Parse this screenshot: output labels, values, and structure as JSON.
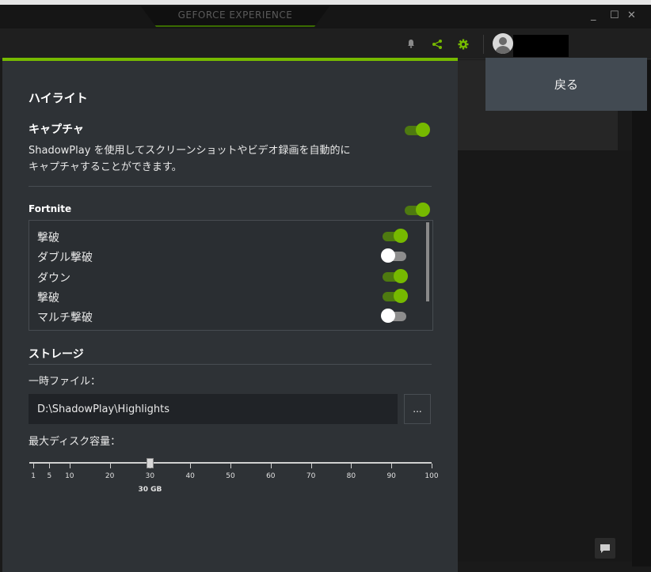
{
  "app": {
    "title": "GEFORCE EXPERIENCE",
    "window_controls": {
      "minimize": "_",
      "maximize": "☐",
      "close": "✕"
    }
  },
  "header": {
    "icons": [
      "bell-icon",
      "share-icon",
      "gear-icon",
      "avatar-icon"
    ]
  },
  "back_label": "戻る",
  "highlights": {
    "title": "ハイライト",
    "capture": {
      "title": "キャプチャ",
      "desc_line1": "ShadowPlay を使用してスクリーンショットやビデオ録画を自動的に",
      "desc_line2": "キャプチャすることができます。",
      "enabled": true
    },
    "game": {
      "name": "Fortnite",
      "enabled": true,
      "events": [
        {
          "label": "撃破",
          "enabled": true
        },
        {
          "label": "ダブル撃破",
          "enabled": false
        },
        {
          "label": "ダウン",
          "enabled": true
        },
        {
          "label": "撃破",
          "enabled": true
        },
        {
          "label": "マルチ撃破",
          "enabled": false
        }
      ]
    }
  },
  "storage": {
    "title": "ストレージ",
    "temp_label": "一時ファイル：",
    "temp_path": "D:\\ShadowPlay\\Highlights",
    "browse_label": "...",
    "max_disk_label": "最大ディスク容量：",
    "slider": {
      "ticks": [
        "1",
        "5",
        "10",
        "20",
        "30",
        "40",
        "50",
        "60",
        "70",
        "80",
        "90",
        "100"
      ],
      "value": 30,
      "value_label": "30 GB"
    }
  },
  "colors": {
    "accent": "#76b900",
    "panel_bg": "#2e3236",
    "back_btn_bg": "#424a52"
  }
}
